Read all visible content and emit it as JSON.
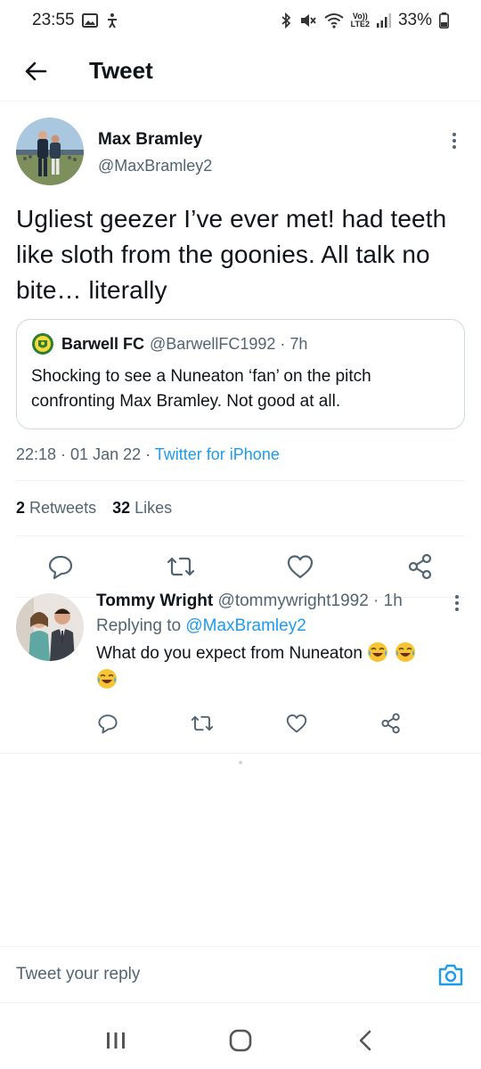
{
  "status_bar": {
    "time": "23:55",
    "network_label_top": "Vo))",
    "network_label_bottom": "LTE2",
    "battery": "33%"
  },
  "header": {
    "title": "Tweet"
  },
  "tweet": {
    "author_name": "Max Bramley",
    "author_handle": "@MaxBramley2",
    "text": "Ugliest geezer I’ve ever met! had teeth like sloth from the goonies. All talk no bite… literally",
    "quote": {
      "name": "Barwell FC",
      "handle_time": "@BarwellFC1992 · 7h",
      "text": "Shocking to see a Nuneaton ‘fan’ on the pitch confronting Max Bramley. Not good at all."
    },
    "timestamp": "22:18 · 01 Jan 22 · ",
    "source": "Twitter for iPhone",
    "retweets_count": "2",
    "retweets_label": "Retweets",
    "likes_count": "32",
    "likes_label": "Likes"
  },
  "reply": {
    "name": "Tommy Wright",
    "handle_time": "@tommywright1992 · 1h",
    "replying_to_label": "Replying to ",
    "replying_to_handle": "@MaxBramley2",
    "text": "What do you expect from Nuneaton"
  },
  "composer": {
    "placeholder": "Tweet your reply"
  },
  "colors": {
    "accent": "#1d9bf0",
    "secondary_text": "#536471",
    "divider": "#eff3f4"
  },
  "icons": {
    "back": "arrow-left-icon",
    "reply": "comment-icon",
    "retweet": "retweet-icon",
    "like": "heart-icon",
    "share": "share-icon",
    "camera": "camera-icon",
    "more": "more-vertical-icon"
  }
}
